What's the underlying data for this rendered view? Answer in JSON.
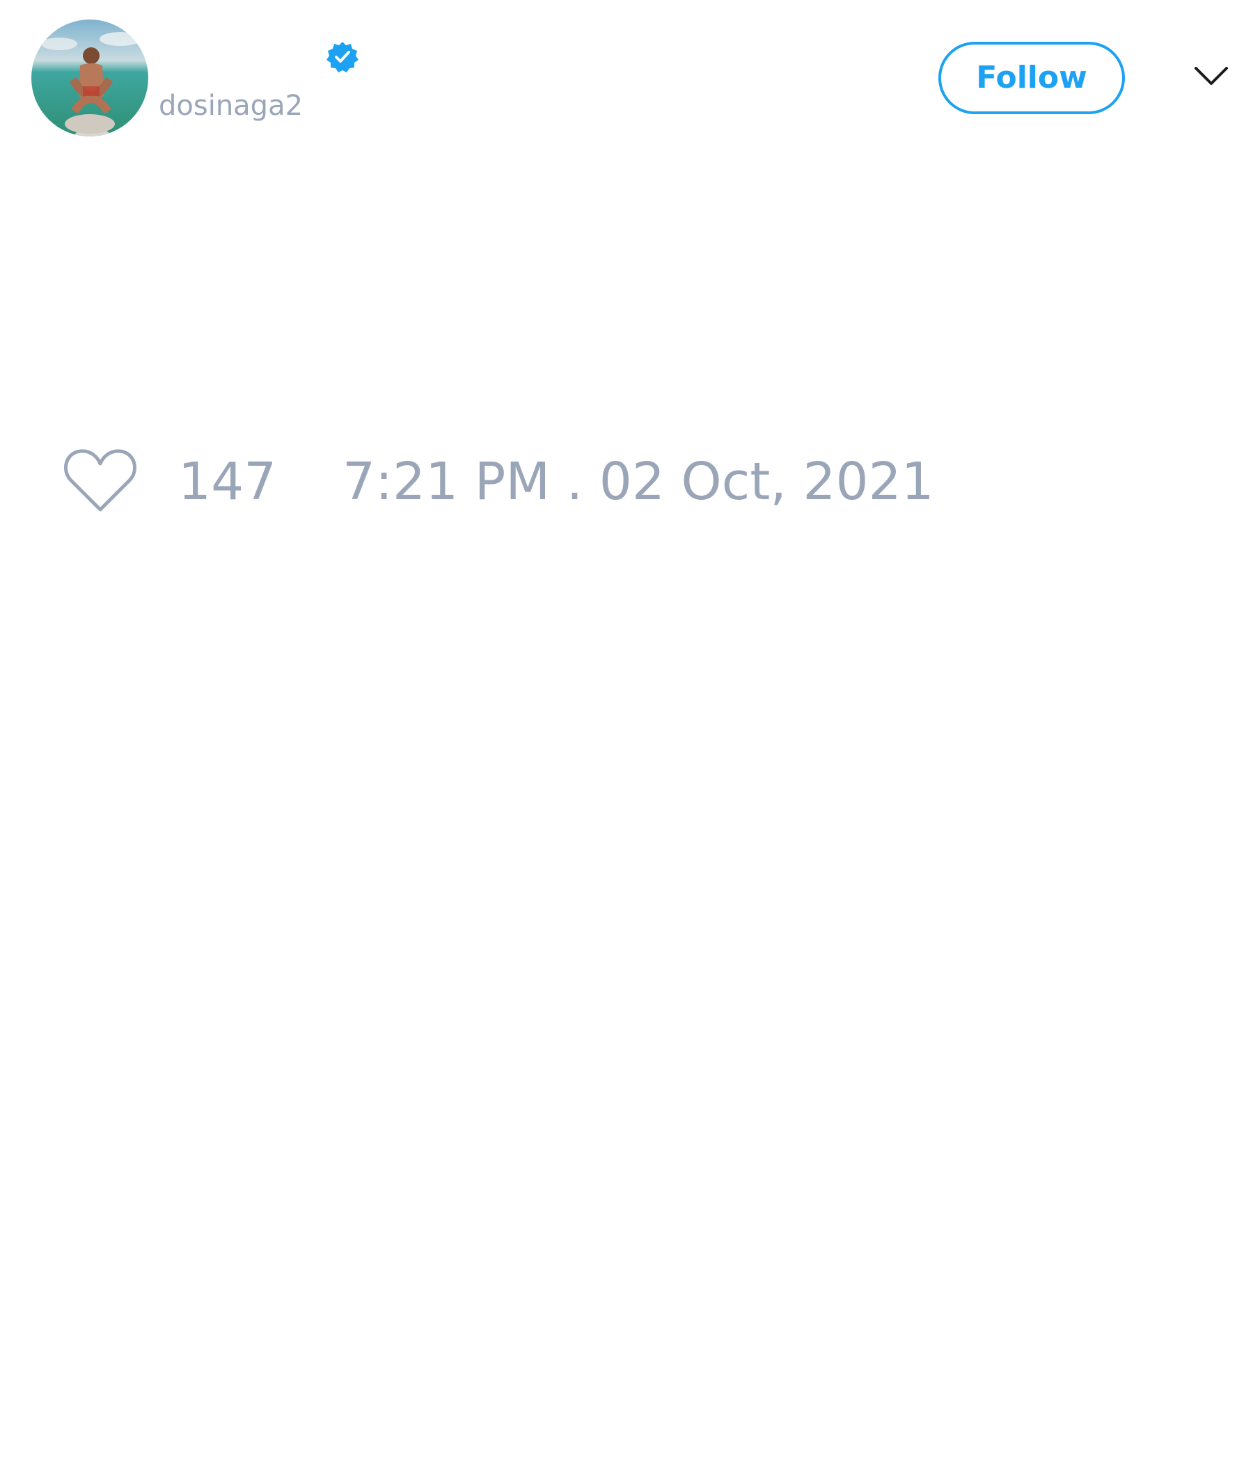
{
  "user": {
    "handle": "dosinaga2",
    "verified": true,
    "avatar_icon": "profile-photo"
  },
  "header": {
    "follow_label": "Follow",
    "menu_icon": "chevron-down-icon"
  },
  "tweet": {
    "like_icon": "heart-outline-icon",
    "likes": "147",
    "timestamp": "7:21 PM . 02 Oct, 2021"
  },
  "colors": {
    "accent": "#1da1f2",
    "muted_text": "#9aa6b8",
    "background": "#ffffff"
  }
}
